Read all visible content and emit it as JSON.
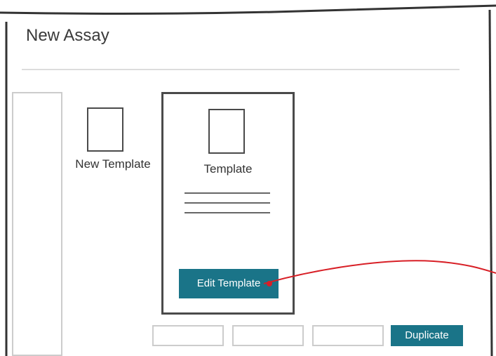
{
  "page": {
    "title": "New Assay"
  },
  "templates": {
    "new_template": {
      "label": "New Template",
      "icon": "document-icon"
    },
    "selected_template": {
      "label": "Template",
      "icon": "document-icon",
      "edit_button_label": "Edit Template"
    }
  },
  "bottom_actions": {
    "buttons": [
      "",
      "",
      ""
    ],
    "duplicate_label": "Duplicate"
  },
  "colors": {
    "accent": "#1a7488",
    "annotation": "#d81f26",
    "border": "#4a4a4a",
    "light_border": "#cccccc"
  }
}
